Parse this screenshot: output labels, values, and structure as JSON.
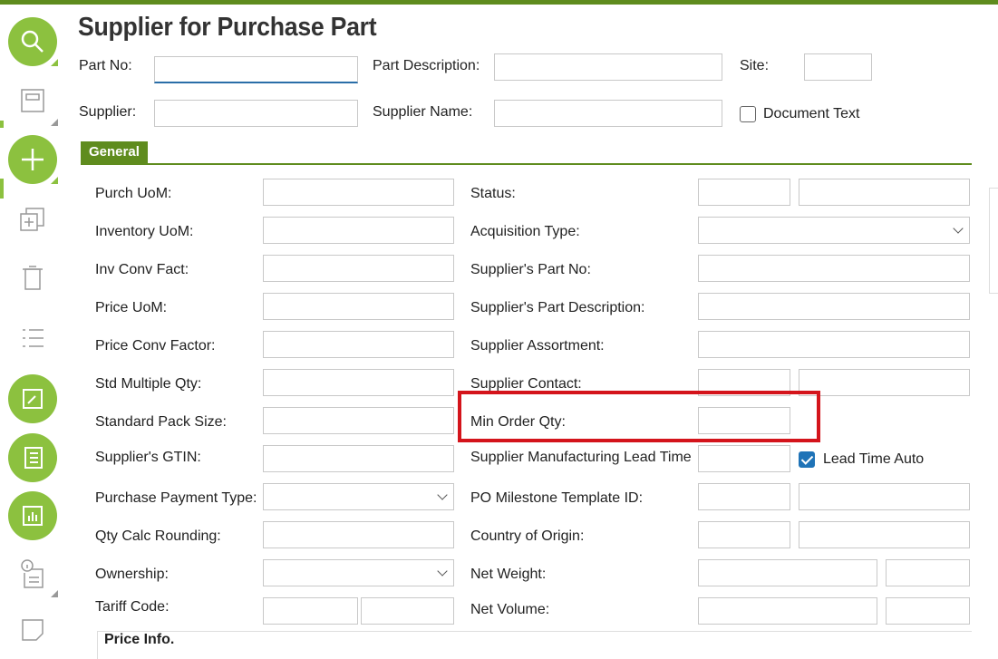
{
  "page": {
    "title": "Supplier for Purchase Part"
  },
  "sidebar": {
    "items": [
      {
        "name": "search-icon"
      },
      {
        "name": "save-icon"
      },
      {
        "name": "new-icon"
      },
      {
        "name": "duplicate-icon"
      },
      {
        "name": "delete-icon"
      },
      {
        "name": "list-icon"
      },
      {
        "name": "navigate-icon"
      },
      {
        "name": "details-icon"
      },
      {
        "name": "chart-icon"
      },
      {
        "name": "info-document-icon"
      },
      {
        "name": "note-icon"
      }
    ],
    "accent_color": "#8cc13f"
  },
  "header": {
    "part_no_label": "Part No:",
    "part_no_value": "",
    "part_description_label": "Part Description:",
    "part_description_value": "",
    "site_label": "Site:",
    "site_value": "",
    "supplier_label": "Supplier:",
    "supplier_value": "",
    "supplier_name_label": "Supplier Name:",
    "supplier_name_value": "",
    "document_text_label": "Document Text",
    "document_text_checked": false
  },
  "tabs": [
    {
      "label": "General",
      "active": true
    }
  ],
  "general": {
    "left": {
      "purch_uom": "Purch UoM:",
      "inventory_uom": "Inventory UoM:",
      "inv_conv_fact": "Inv Conv Fact:",
      "price_uom": "Price UoM:",
      "price_conv_factor": "Price Conv Factor:",
      "std_multiple_qty": "Std Multiple Qty:",
      "standard_pack_size": "Standard Pack Size:",
      "suppliers_gtin": "Supplier's GTIN:",
      "purchase_payment_type": "Purchase Payment Type:",
      "qty_calc_rounding": "Qty Calc Rounding:",
      "ownership": "Ownership:",
      "tariff_code": "Tariff Code:"
    },
    "right": {
      "status": "Status:",
      "acquisition_type": "Acquisition Type:",
      "suppliers_part_no": "Supplier's Part No:",
      "suppliers_part_description": "Supplier's Part Description:",
      "supplier_assortment": "Supplier Assortment:",
      "supplier_contact": "Supplier Contact:",
      "min_order_qty": "Min Order Qty:",
      "supplier_mfg_lead_time": "Supplier Manufacturing Lead Time",
      "lead_time_auto": "Lead Time Auto",
      "lead_time_auto_checked": true,
      "po_milestone_template_id": "PO Milestone Template ID:",
      "country_of_origin": "Country of Origin:",
      "net_weight": "Net Weight:",
      "net_volume": "Net Volume:"
    }
  },
  "price_info": {
    "title": "Price Info."
  },
  "colors": {
    "brand_green": "#5f8c1e",
    "highlight_red": "#d4141b",
    "checkbox_blue": "#1f73b7"
  }
}
